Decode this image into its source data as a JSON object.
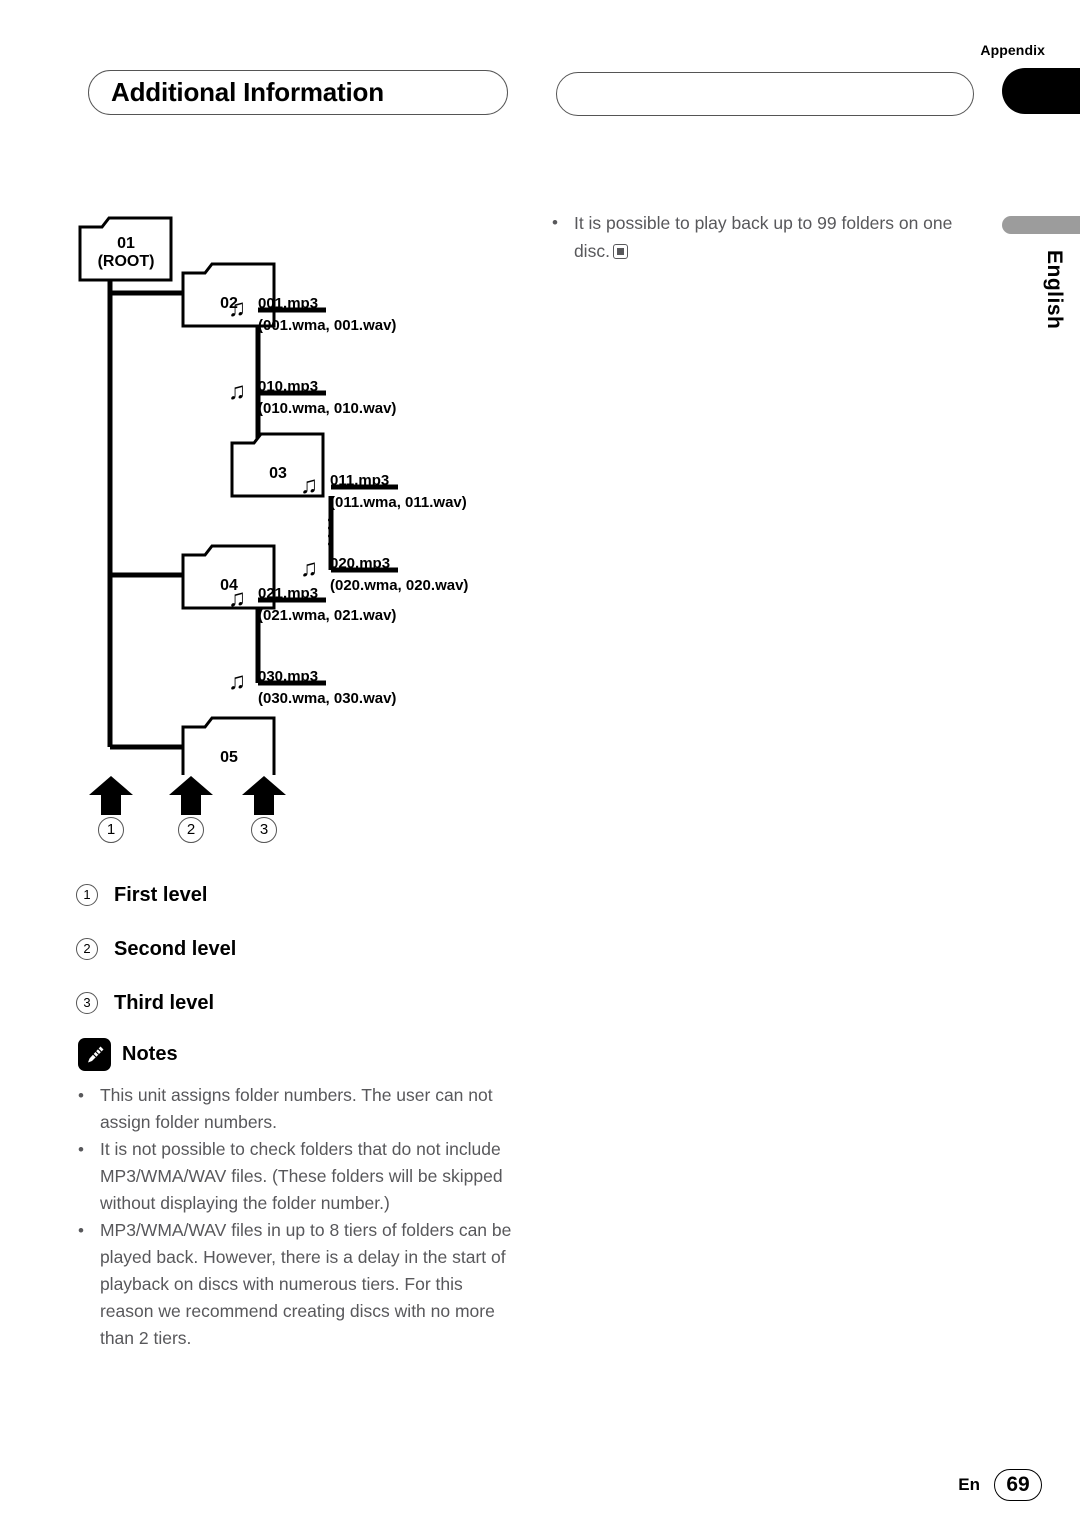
{
  "header": {
    "section_tab": "Appendix",
    "title": "Additional Information",
    "secondary_pill": "",
    "language_tab": "English"
  },
  "right_column": {
    "bullets": [
      "It is possible to play back up to 99 folders on one disc."
    ],
    "end_mark_icon": "end-of-section-square"
  },
  "diagram": {
    "folders": [
      {
        "id": "f01",
        "label": "01\n(ROOT)",
        "line1": "01",
        "line2": "(ROOT)",
        "level": 1
      },
      {
        "id": "f02",
        "label": "02",
        "line1": "02",
        "line2": "",
        "level": 2
      },
      {
        "id": "f03",
        "label": "03",
        "line1": "03",
        "line2": "",
        "level": 3
      },
      {
        "id": "f04",
        "label": "04",
        "line1": "04",
        "line2": "",
        "level": 2
      },
      {
        "id": "f05",
        "label": "05",
        "line1": "05",
        "line2": "",
        "level": 2
      }
    ],
    "files": [
      {
        "parent": "f02",
        "primary": "001.mp3",
        "alternates": "(001.wma, 001.wav)"
      },
      {
        "parent": "f02",
        "primary": "010.mp3",
        "alternates": "(010.wma, 010.wav)"
      },
      {
        "parent": "f03",
        "primary": "011.mp3",
        "alternates": "(011.wma, 011.wav)"
      },
      {
        "parent": "f03",
        "primary": "020.mp3",
        "alternates": "(020.wma, 020.wav)"
      },
      {
        "parent": "f04",
        "primary": "021.mp3",
        "alternates": "(021.wma, 021.wav)"
      },
      {
        "parent": "f04",
        "primary": "030.mp3",
        "alternates": "(030.wma, 030.wav)"
      }
    ],
    "note_icon": "music-note-icon",
    "folder_icon": "folder-icon",
    "ellipsis_icon": "vertical-ellipsis-icon",
    "callouts": [
      "1",
      "2",
      "3"
    ],
    "arrow_icon": "up-arrow-icon"
  },
  "legend": [
    {
      "number": "1",
      "label": "First level"
    },
    {
      "number": "2",
      "label": "Second level"
    },
    {
      "number": "3",
      "label": "Third level"
    }
  ],
  "notes": {
    "icon": "pencil-icon",
    "title": "Notes",
    "items": [
      "This unit assigns folder numbers. The user can not assign folder numbers.",
      "It is not possible to check folders that do not include MP3/WMA/WAV files. (These folders will be skipped without displaying the folder number.)",
      "MP3/WMA/WAV files in up to 8 tiers of folders can be played back. However, there is a delay in the start of playback on discs with numerous tiers. For this reason we recommend creating discs with no more than 2 tiers."
    ]
  },
  "footer": {
    "language_code": "En",
    "page_number": "69"
  },
  "colors": {
    "body_text": "#58585b",
    "heading": "#000000",
    "tab_black": "#000000",
    "tab_gray": "#9c9c9c"
  }
}
